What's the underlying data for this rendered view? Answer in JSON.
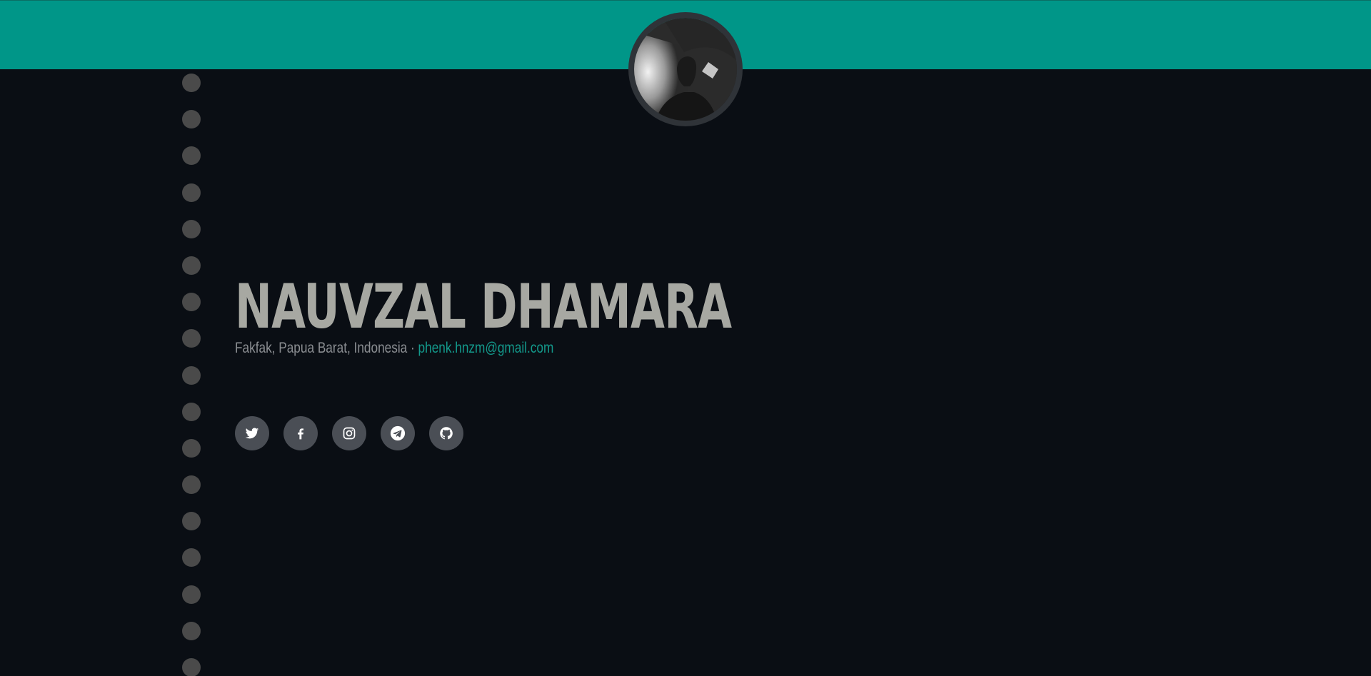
{
  "profile": {
    "name": "NAUVZAL DHAMARA",
    "location": "Fakfak, Papua Barat, Indonesia",
    "separator": " · ",
    "email": "phenk.hnzm@gmail.com"
  },
  "social_links": [
    {
      "icon": "twitter-icon"
    },
    {
      "icon": "facebook-icon"
    },
    {
      "icon": "instagram-icon"
    },
    {
      "icon": "telegram-icon"
    },
    {
      "icon": "github-icon"
    }
  ],
  "side_nav": {
    "dot_count": 17
  },
  "colors": {
    "accent": "#009688",
    "background": "#0a0e14",
    "name_text": "#a7a8a2",
    "muted_text": "#8b8e92",
    "email_link": "#139a8c",
    "social_button": "#4a4e55",
    "dot": "#4a4a4a"
  }
}
